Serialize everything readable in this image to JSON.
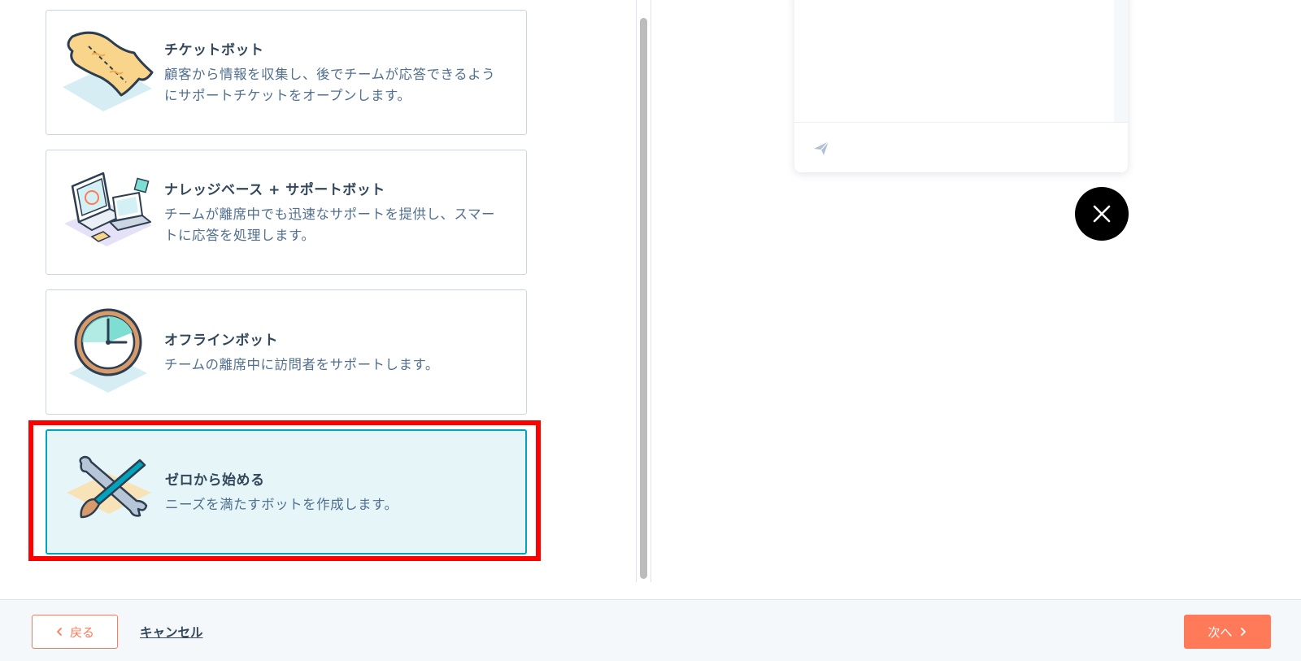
{
  "bot_templates": [
    {
      "title": "チケットボット",
      "description_line1": "顧客から情報を収集し、後でチームが応答できるよう",
      "description_line2": "にサポートチケットをオープンします。",
      "icon": "ticket-icon",
      "selected": false
    },
    {
      "title": "ナレッジベース + サポートボット",
      "description_line1": "チームが離席中でも迅速なサポートを提供し、スマー",
      "description_line2": "トに応答を処理します。",
      "icon": "computer-icon",
      "selected": false
    },
    {
      "title": "オフラインボット",
      "description_line1": "チームの離席中に訪問者をサポートします。",
      "description_line2": "",
      "icon": "clock-icon",
      "selected": false
    },
    {
      "title": "ゼロから始める",
      "description_line1": "ニーズを満たすボットを作成します。",
      "description_line2": "",
      "icon": "tools-icon",
      "selected": true
    }
  ],
  "chat_preview": {
    "send_icon": "paper-plane-icon",
    "close_icon": "close-icon"
  },
  "footer": {
    "back_label": "戻る",
    "cancel_label": "キャンセル",
    "next_label": "次へ"
  },
  "colors": {
    "accent": "#ff7a59",
    "selected_bg": "#e5f5f8",
    "selected_border": "#00a4bd",
    "highlight": "#ff0000",
    "text_dark": "#33475b",
    "text_muted": "#516f90"
  }
}
